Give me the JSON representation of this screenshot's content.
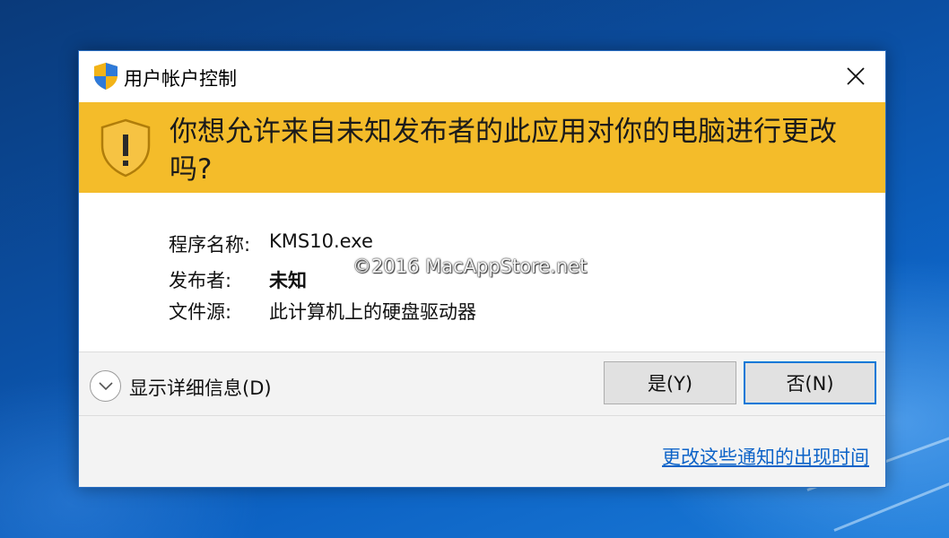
{
  "dialog": {
    "title": "用户帐户控制",
    "close_icon": "close-icon",
    "prompt": "你想允许来自未知发布者的此应用对你的电脑进行更改吗?",
    "details": {
      "program_label": "程序名称:",
      "program_value": "KMS10.exe",
      "publisher_label": "发布者:",
      "publisher_value": "未知",
      "source_label": "文件源:",
      "source_value": "此计算机上的硬盘驱动器"
    },
    "watermark": "©2016 MacAppStore.net",
    "show_details_label": "显示详细信息(D)",
    "yes_button": "是(Y)",
    "no_button": "否(N)",
    "notification_link": "更改这些通知的出现时间"
  },
  "colors": {
    "banner": "#f4bc2a",
    "link": "#0d63c8",
    "focus_border": "#0078d7"
  }
}
